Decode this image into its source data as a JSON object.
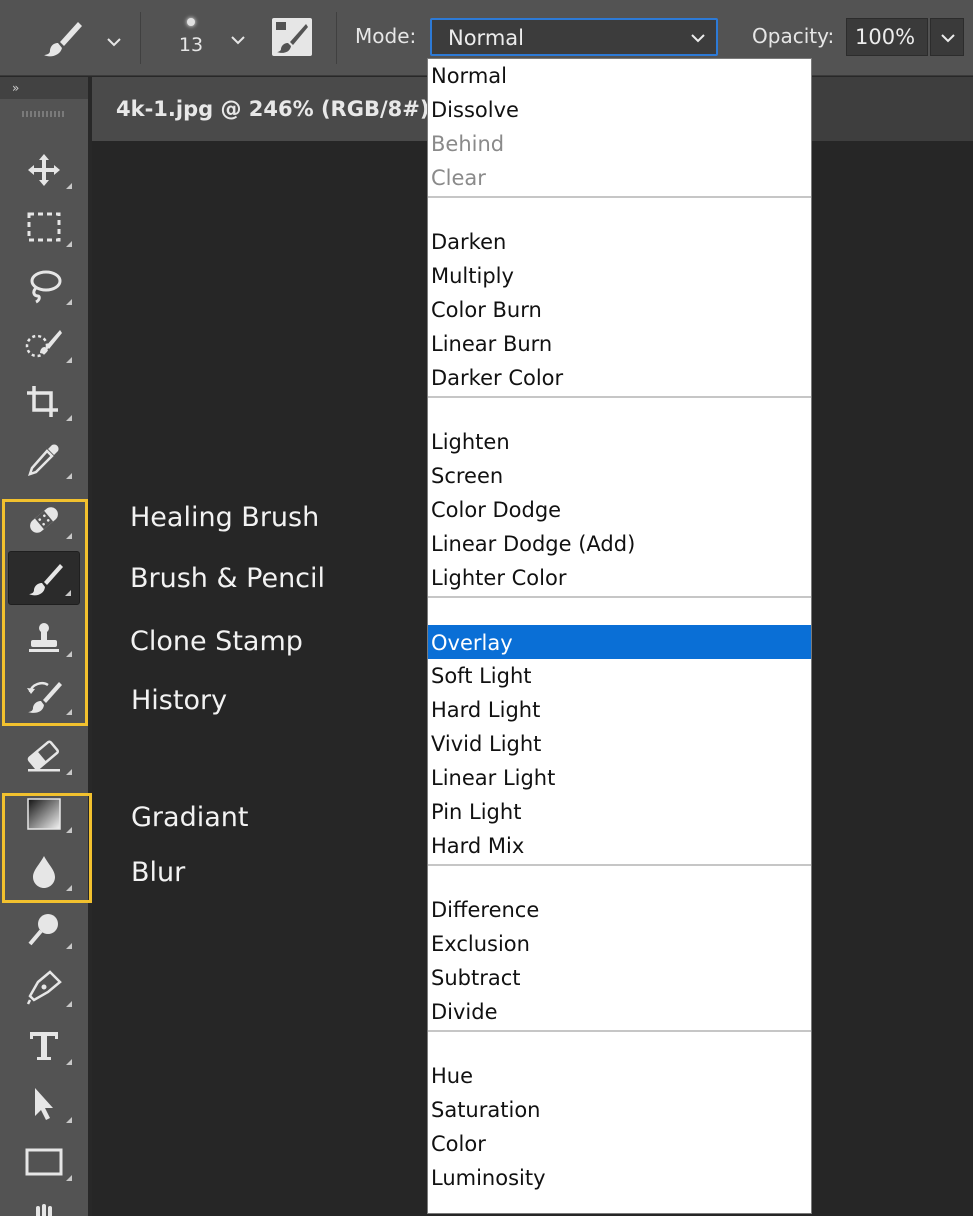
{
  "options_bar": {
    "brush_size": "13",
    "mode_label": "Mode:",
    "mode_value": "Normal",
    "opacity_label": "Opacity:",
    "opacity_value": "100%"
  },
  "toolbar": {
    "collapse_glyph": "»",
    "tools": [
      {
        "name": "move-tool",
        "icon": "move-icon"
      },
      {
        "name": "marquee-tool",
        "icon": "rect-marquee-icon"
      },
      {
        "name": "lasso-tool",
        "icon": "lasso-icon"
      },
      {
        "name": "quick-selection-tool",
        "icon": "quick-selection-icon"
      },
      {
        "name": "crop-tool",
        "icon": "crop-icon"
      },
      {
        "name": "eyedropper-tool",
        "icon": "eyedropper-icon"
      },
      {
        "name": "healing-brush-tool",
        "icon": "bandage-icon"
      },
      {
        "name": "brush-tool",
        "icon": "brush-icon",
        "active": true
      },
      {
        "name": "clone-stamp-tool",
        "icon": "stamp-icon"
      },
      {
        "name": "history-brush-tool",
        "icon": "history-brush-icon"
      },
      {
        "name": "eraser-tool",
        "icon": "eraser-icon"
      },
      {
        "name": "gradient-tool",
        "icon": "gradient-icon"
      },
      {
        "name": "blur-tool",
        "icon": "drop-icon"
      },
      {
        "name": "dodge-tool",
        "icon": "dodge-icon"
      },
      {
        "name": "pen-tool",
        "icon": "pen-icon"
      },
      {
        "name": "type-tool",
        "icon": "type-icon"
      },
      {
        "name": "path-selection-tool",
        "icon": "arrow-icon"
      },
      {
        "name": "rectangle-tool",
        "icon": "rectangle-icon"
      },
      {
        "name": "hand-tool",
        "icon": "hand-icon"
      }
    ],
    "highlight_color": "#f2c12e"
  },
  "document": {
    "tab_title": "4k-1.jpg @ 246% (RGB/8#)"
  },
  "annotations": {
    "healing_brush": "Healing Brush",
    "brush_pencil": "Brush & Pencil",
    "clone_stamp": "Clone Stamp",
    "history": "History",
    "gradient": "Gradiant",
    "blur": "Blur"
  },
  "blend_modes": {
    "selected_color": "#0a6fd6",
    "groups": [
      [
        {
          "label": "Normal"
        },
        {
          "label": "Dissolve"
        },
        {
          "label": "Behind",
          "disabled": true
        },
        {
          "label": "Clear",
          "disabled": true
        }
      ],
      [
        {
          "label": "Darken"
        },
        {
          "label": "Multiply"
        },
        {
          "label": "Color Burn"
        },
        {
          "label": "Linear Burn"
        },
        {
          "label": "Darker Color"
        }
      ],
      [
        {
          "label": "Lighten"
        },
        {
          "label": "Screen"
        },
        {
          "label": "Color Dodge"
        },
        {
          "label": "Linear Dodge (Add)"
        },
        {
          "label": "Lighter Color"
        }
      ],
      [
        {
          "label": "Overlay",
          "selected": true
        },
        {
          "label": "Soft Light"
        },
        {
          "label": "Hard Light"
        },
        {
          "label": "Vivid Light"
        },
        {
          "label": "Linear Light"
        },
        {
          "label": "Pin Light"
        },
        {
          "label": "Hard Mix"
        }
      ],
      [
        {
          "label": "Difference"
        },
        {
          "label": "Exclusion"
        },
        {
          "label": "Subtract"
        },
        {
          "label": "Divide"
        }
      ],
      [
        {
          "label": "Hue"
        },
        {
          "label": "Saturation"
        },
        {
          "label": "Color"
        },
        {
          "label": "Luminosity"
        }
      ]
    ]
  }
}
